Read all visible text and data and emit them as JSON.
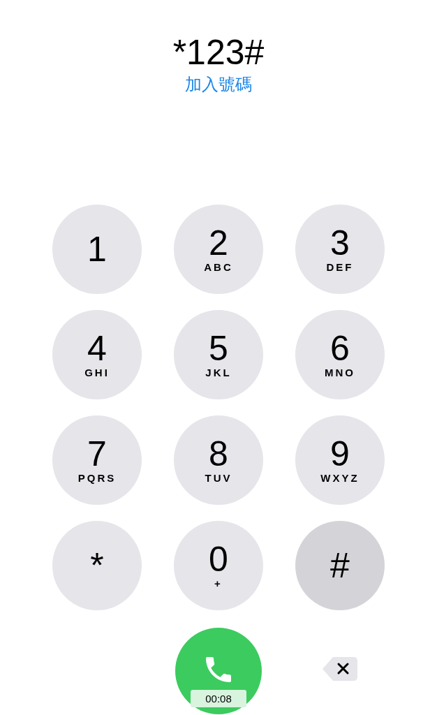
{
  "display": {
    "number": "*123#",
    "add_number_link": "加入號碼"
  },
  "keys": [
    {
      "digit": "1",
      "pressed": false
    },
    {
      "digit": "2",
      "letters": "ABC",
      "pressed": false
    },
    {
      "digit": "3",
      "letters": "DEF",
      "pressed": false
    },
    {
      "digit": "4",
      "letters": "GHI",
      "pressed": false
    },
    {
      "digit": "5",
      "letters": "JKL",
      "pressed": false
    },
    {
      "digit": "6",
      "letters": "MNO",
      "pressed": false
    },
    {
      "digit": "7",
      "letters": "PQRS",
      "pressed": false
    },
    {
      "digit": "8",
      "letters": "TUV",
      "pressed": false
    },
    {
      "digit": "9",
      "letters": "WXYZ",
      "pressed": false
    },
    {
      "digit": "*",
      "pressed": false
    },
    {
      "digit": "0",
      "letters": "+",
      "pressed": false
    },
    {
      "digit": "#",
      "pressed": true
    }
  ],
  "call": {
    "timer": "00:08"
  }
}
